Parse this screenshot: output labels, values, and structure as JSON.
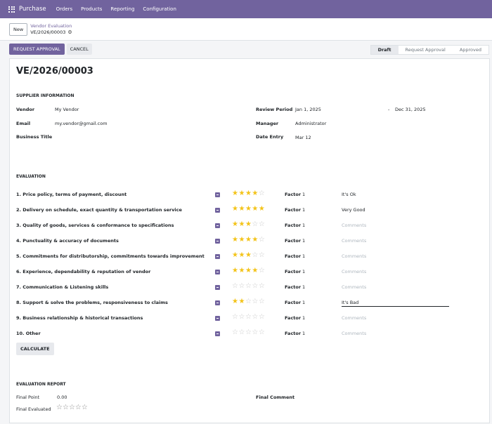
{
  "nav": {
    "brand": "Purchase",
    "menus": [
      "Orders",
      "Products",
      "Reporting",
      "Configuration"
    ]
  },
  "control_panel": {
    "new_label": "New",
    "breadcrumb_parent": "Vendor Evaluation",
    "breadcrumb_current": "VE/2026/00003"
  },
  "statusbar": {
    "request_approval": "REQUEST APPROVAL",
    "cancel": "CANCEL",
    "stages": [
      "Draft",
      "Request Approval",
      "Approved"
    ],
    "active_stage": "Draft"
  },
  "record": {
    "title": "VE/2026/00003",
    "supplier_section": "SUPPLIER INFORMATION",
    "vendor_label": "Vendor",
    "vendor": "My Vendor",
    "email_label": "Email",
    "email": "my.vendor@gmail.com",
    "business_title_label": "Business Title",
    "review_period_label": "Review Period",
    "review_start": "Jan 1, 2025",
    "review_sep": "-",
    "review_end": "Dec 31, 2025",
    "manager_label": "Manager",
    "manager": "Administrator",
    "date_entry_label": "Date Entry",
    "date_entry": "Mar 12"
  },
  "evaluation": {
    "section": "EVALUATION",
    "factor_label": "Factor",
    "comment_placeholder": "Comments",
    "max_stars": 5,
    "criteria": [
      {
        "label": "1. Price policy, terms of payment, discount",
        "stars": 4,
        "factor": "1",
        "comment": "It's Ok"
      },
      {
        "label": "2. Delivery on schedule, exact quantity & transportation service",
        "stars": 5,
        "factor": "1",
        "comment": "Very Good"
      },
      {
        "label": "3. Quality of goods, services & conformance to specifications",
        "stars": 3,
        "factor": "1",
        "comment": ""
      },
      {
        "label": "4. Punctuality & accuracy of documents",
        "stars": 4,
        "factor": "1",
        "comment": ""
      },
      {
        "label": "5. Commitments for distributorship, commitments towards improvement",
        "stars": 3,
        "factor": "1",
        "comment": ""
      },
      {
        "label": "6. Experience, dependability & reputation of vendor",
        "stars": 4,
        "factor": "1",
        "comment": ""
      },
      {
        "label": "7. Communication & Listening skills",
        "stars": 0,
        "factor": "1",
        "comment": ""
      },
      {
        "label": "8. Support & solve the problems, responsiveness to claims",
        "stars": 2,
        "factor": "1",
        "comment": "It's Bad"
      },
      {
        "label": "9. Business relationship & historical transactions",
        "stars": 0,
        "factor": "1",
        "comment": ""
      },
      {
        "label": "10. Other",
        "stars": 0,
        "factor": "1",
        "comment": ""
      }
    ],
    "calculate_label": "CALCULATE"
  },
  "report": {
    "section": "EVALUATION REPORT",
    "final_point_label": "Final Point",
    "final_point": "0.00",
    "final_evaluated_label": "Final Evaluated",
    "final_evaluated_stars": 0,
    "final_comment_label": "Final Comment"
  },
  "colors": {
    "brand": "#71639e",
    "star_on": "#f3c318",
    "star_off": "#c9c9c9"
  },
  "icons": [
    "apps-grid-icon",
    "gear-icon",
    "checkbox-icon",
    "star-icon"
  ]
}
